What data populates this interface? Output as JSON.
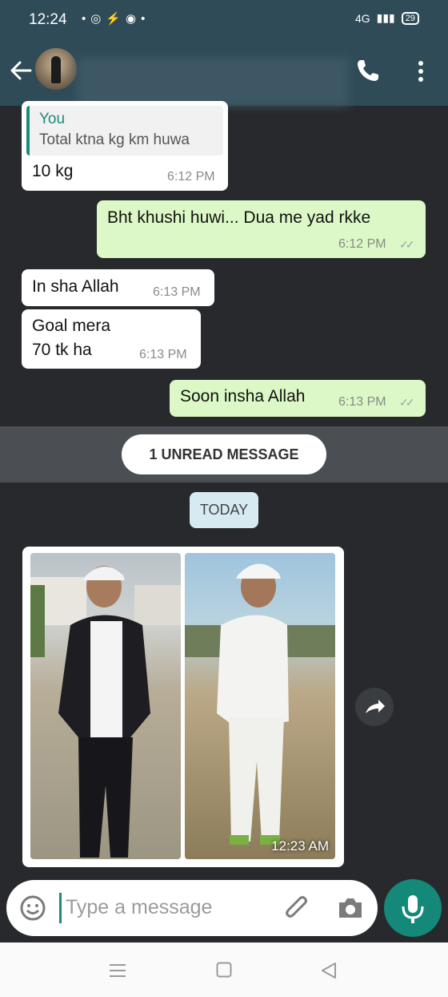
{
  "status": {
    "time": "12:24",
    "network": "4G",
    "battery": "29"
  },
  "chat": {
    "messages": [
      {
        "dir": "in",
        "quote_name": "You",
        "quote_text": "Total ktna kg km huwa",
        "text": "10 kg",
        "time": "6:12 PM"
      },
      {
        "dir": "out",
        "text": "Bht khushi huwi... Dua me yad rkke",
        "time": "6:12 PM",
        "status": "read"
      },
      {
        "dir": "in",
        "text": "In sha Allah",
        "time": "6:13 PM"
      },
      {
        "dir": "in",
        "text_line1": "Goal mera",
        "text_line2": "70 tk ha",
        "time": "6:13 PM"
      },
      {
        "dir": "out",
        "text": "Soon insha Allah",
        "time": "6:13 PM",
        "status": "read"
      }
    ],
    "unread_label": "1 UNREAD MESSAGE",
    "date_label": "TODAY",
    "photo_message": {
      "time": "12:23 AM"
    }
  },
  "input": {
    "placeholder": "Type a message"
  },
  "colors": {
    "header": "#2f4b57",
    "outgoing": "#dcf8c6",
    "accent": "#14897a"
  }
}
